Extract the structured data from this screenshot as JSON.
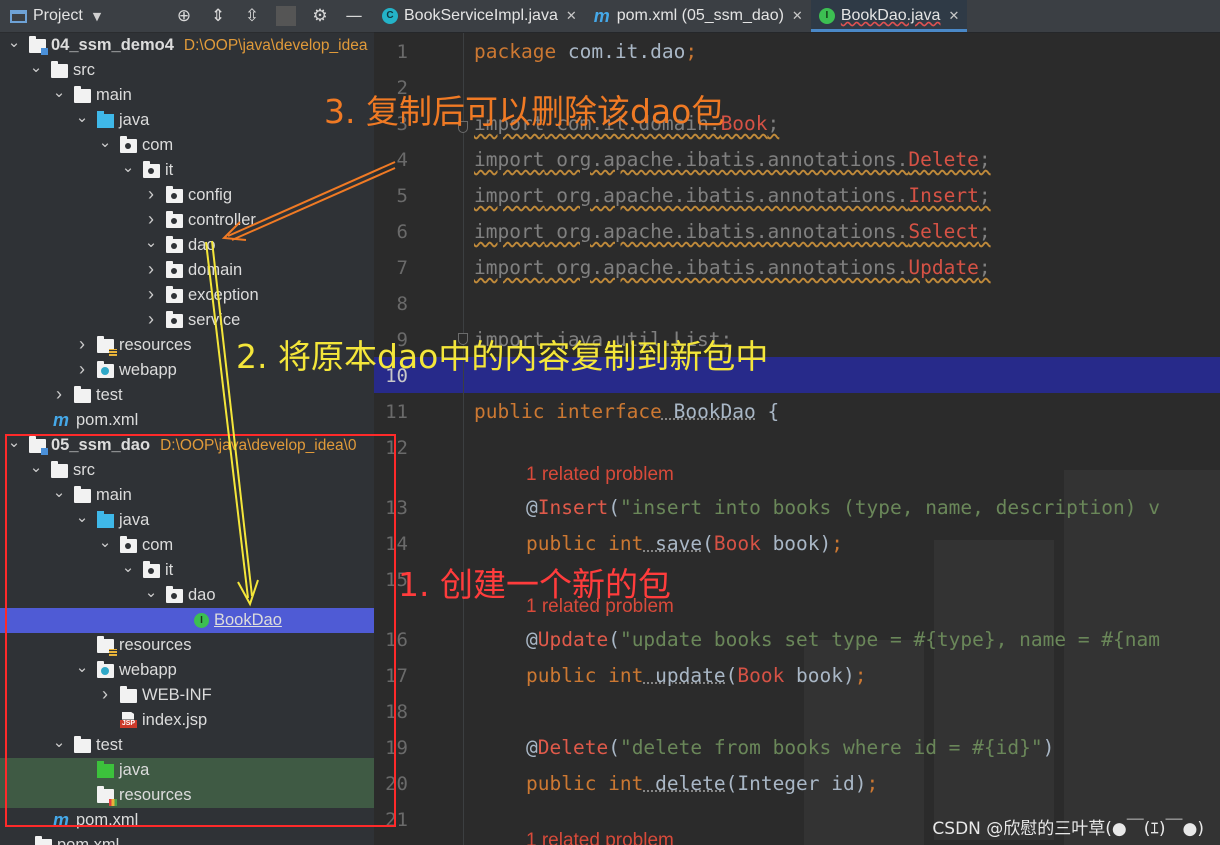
{
  "project_panel": {
    "title": "Project",
    "tools": [
      "target-icon",
      "expand-all-icon",
      "collapse-all-icon",
      "gear-icon",
      "minimize-icon"
    ],
    "rows": [
      {
        "label": "04_ssm_demo4",
        "path": "D:\\OOP\\java\\develop_idea"
      },
      {
        "label": "src"
      },
      {
        "label": "main"
      },
      {
        "label": "java"
      },
      {
        "label": "com"
      },
      {
        "label": "it"
      },
      {
        "label": "config"
      },
      {
        "label": "controller"
      },
      {
        "label": "dao"
      },
      {
        "label": "domain"
      },
      {
        "label": "exception"
      },
      {
        "label": "service"
      },
      {
        "label": "resources"
      },
      {
        "label": "webapp"
      },
      {
        "label": "test"
      },
      {
        "label": "pom.xml"
      },
      {
        "label": "05_ssm_dao",
        "path": "D:\\OOP\\java\\develop_idea\\0"
      },
      {
        "label": "src"
      },
      {
        "label": "main"
      },
      {
        "label": "java"
      },
      {
        "label": "com"
      },
      {
        "label": "it"
      },
      {
        "label": "dao"
      },
      {
        "label": "BookDao"
      },
      {
        "label": "resources"
      },
      {
        "label": "webapp"
      },
      {
        "label": "WEB-INF"
      },
      {
        "label": "index.jsp"
      },
      {
        "label": "test"
      },
      {
        "label": "java"
      },
      {
        "label": "resources"
      },
      {
        "label": "pom.xml"
      },
      {
        "label": "pom.xml"
      }
    ]
  },
  "tabs": [
    {
      "label": "BookServiceImpl.java",
      "icon": "class-icon",
      "active": false
    },
    {
      "label": "pom.xml (05_ssm_dao)",
      "icon": "maven-icon",
      "active": false
    },
    {
      "label": "BookDao.java",
      "icon": "interface-icon",
      "active": true
    }
  ],
  "editor": {
    "line_numbers": [
      "1",
      "2",
      "3",
      "4",
      "5",
      "6",
      "7",
      "8",
      "9",
      "10",
      "11",
      "12",
      "13",
      "14",
      "15",
      "16",
      "17",
      "18",
      "19",
      "20",
      "21"
    ],
    "current_line": "10",
    "code": {
      "l1_kw": "package",
      "l1_rest": " com.it.dao",
      "l1_semi": ";",
      "l3_kw": "import",
      "l3_rest": " com.it.domain.",
      "l3_cls": "Book",
      "l3_semi": ";",
      "l4_kw": "import",
      "l4_rest": " org.apache.ibatis.annotations.",
      "l4_cls": "Delete",
      "l4_semi": ";",
      "l5_kw": "import",
      "l5_rest": " org.apache.ibatis.annotations.",
      "l5_cls": "Insert",
      "l5_semi": ";",
      "l6_kw": "import",
      "l6_rest": " org.apache.ibatis.annotations.",
      "l6_cls": "Select",
      "l6_semi": ";",
      "l7_kw": "import",
      "l7_rest": " org.apache.ibatis.annotations.",
      "l7_cls": "Update",
      "l7_semi": ";",
      "l9_text": "import java.util.List;",
      "l11_kw": "public interface",
      "l11_name": " BookDao",
      "l11_rest": " {",
      "hint_1": "1 related problem",
      "l13_at": "@",
      "l13_ann": "Insert",
      "l13_p": "(",
      "l13_str": "\"insert into books (type, name, description) v",
      "l14_kw": "public int",
      "l14_m": " save",
      "l14_p": "(",
      "l14_cls": "Book",
      "l14_rest": " book)",
      "l14_semi": ";",
      "hint_2": "1 related problem",
      "l16_at": "@",
      "l16_ann": "Update",
      "l16_p": "(",
      "l16_str": "\"update books set type = #{type}, name = #{nam",
      "l17_kw": "public int",
      "l17_m": " update",
      "l17_p": "(",
      "l17_cls": "Book",
      "l17_rest": " book)",
      "l17_semi": ";",
      "l19_at": "@",
      "l19_ann": "Delete",
      "l19_p": "(",
      "l19_str": "\"delete from books where id = #{id}\"",
      "l19_close": ")",
      "l20_kw": "public int",
      "l20_m": " delete",
      "l20_p": "(",
      "l20_type": "Integer id",
      "l20_close": ")",
      "l20_semi": ";",
      "hint_3": "1 related problem"
    }
  },
  "annotations": {
    "note1": "1. 创建一个新的包",
    "note2": "2. 将原本dao中的内容复制到新包中",
    "note3": "3. 复制后可以删除该dao包"
  },
  "watermark": "CSDN @欣慰的三叶草(●￣(ｴ)￣●)",
  "colors": {
    "note1": "#ff3c3c",
    "note2": "#f4e63a",
    "note3": "#f07a24",
    "selection": "#4f5bd5",
    "current_line": "#272a8a"
  }
}
